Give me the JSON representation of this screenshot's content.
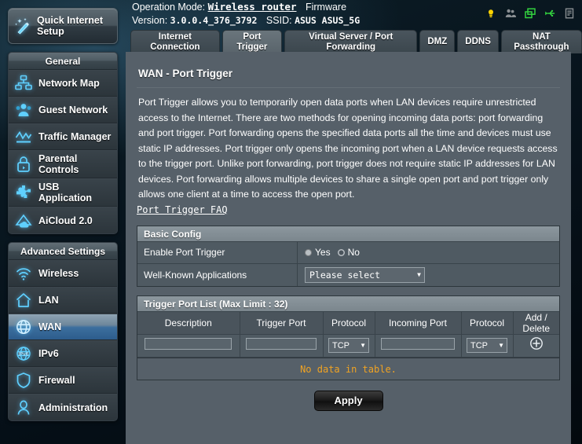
{
  "sidebar": {
    "quick_setup": {
      "label": "Quick Internet Setup",
      "icon": "magic-wand-icon"
    },
    "groups": [
      {
        "title": "General",
        "items": [
          {
            "label": "Network Map",
            "icon": "network-map-icon",
            "active": false
          },
          {
            "label": "Guest Network",
            "icon": "guest-network-icon",
            "active": false
          },
          {
            "label": "Traffic Manager",
            "icon": "traffic-manager-icon",
            "active": false
          },
          {
            "label": "Parental Controls",
            "icon": "parental-controls-icon",
            "active": false
          },
          {
            "label": "USB Application",
            "icon": "usb-application-icon",
            "active": false
          },
          {
            "label": "AiCloud 2.0",
            "icon": "aicloud-icon",
            "active": false
          }
        ]
      },
      {
        "title": "Advanced Settings",
        "items": [
          {
            "label": "Wireless",
            "icon": "wireless-icon",
            "active": false
          },
          {
            "label": "LAN",
            "icon": "lan-home-icon",
            "active": false
          },
          {
            "label": "WAN",
            "icon": "wan-globe-icon",
            "active": true
          },
          {
            "label": "IPv6",
            "icon": "ipv6-icon",
            "active": false
          },
          {
            "label": "Firewall",
            "icon": "firewall-shield-icon",
            "active": false
          },
          {
            "label": "Administration",
            "icon": "administration-user-icon",
            "active": false
          }
        ]
      }
    ]
  },
  "topbar": {
    "operation_mode_label": "Operation Mode:",
    "operation_mode_value": "Wireless router",
    "firmware_label": "Firmware",
    "version_label": "Version:",
    "version_value": "3.0.0.4_376_3792",
    "ssid_label": "SSID:",
    "ssid_value": "ASUS ASUS_5G",
    "status_icons": [
      {
        "name": "notification-bulb-icon",
        "color": "#ffd400"
      },
      {
        "name": "clients-people-icon",
        "color": "#8a8f93"
      },
      {
        "name": "display-monitor-icon",
        "color": "#33d13f"
      },
      {
        "name": "usb-device-icon",
        "color": "#33d13f"
      },
      {
        "name": "printer-icon",
        "color": "#8a8f93"
      }
    ]
  },
  "tabs": [
    {
      "label": "Internet Connection",
      "active": false
    },
    {
      "label": "Port Trigger",
      "active": true
    },
    {
      "label": "Virtual Server / Port Forwarding",
      "active": false
    },
    {
      "label": "DMZ",
      "active": false
    },
    {
      "label": "DDNS",
      "active": false
    },
    {
      "label": "NAT Passthrough",
      "active": false
    }
  ],
  "main": {
    "title": "WAN - Port Trigger",
    "description": "Port Trigger allows you to temporarily open data ports when LAN devices require unrestricted access to the Internet. There are two methods for opening incoming data ports: port forwarding and port trigger. Port forwarding opens the specified data ports all the time and devices must use static IP addresses. Port trigger only opens the incoming port when a LAN device requests access to the trigger port. Unlike port forwarding, port trigger does not require static IP addresses for LAN devices. Port forwarding allows multiple devices to share a single open port and port trigger only allows one client at a time to access the open port.",
    "faq_link": "Port Trigger FAQ",
    "basic_config": {
      "heading": "Basic Config",
      "enable_label": "Enable Port Trigger",
      "enable_options": [
        {
          "label": "Yes",
          "selected": true
        },
        {
          "label": "No",
          "selected": false
        }
      ],
      "well_known_label": "Well-Known Applications",
      "well_known_value": "Please select"
    },
    "trigger_table": {
      "heading": "Trigger Port List (Max Limit : 32)",
      "columns": [
        "Description",
        "Trigger Port",
        "Protocol",
        "Incoming Port",
        "Protocol",
        "Add / Delete"
      ],
      "entry_row": {
        "description": "",
        "trigger_port": "",
        "trigger_protocol": "TCP",
        "incoming_port": "",
        "incoming_protocol": "TCP",
        "add_icon": "plus-circle-icon"
      },
      "rows": [],
      "empty_message": "No data in table."
    },
    "apply_label": "Apply"
  },
  "colors": {
    "panel_bg": "#566069",
    "accent_active": "#2d5c8c",
    "warning_text": "#f0a323",
    "header_bg": "#8c979e"
  }
}
